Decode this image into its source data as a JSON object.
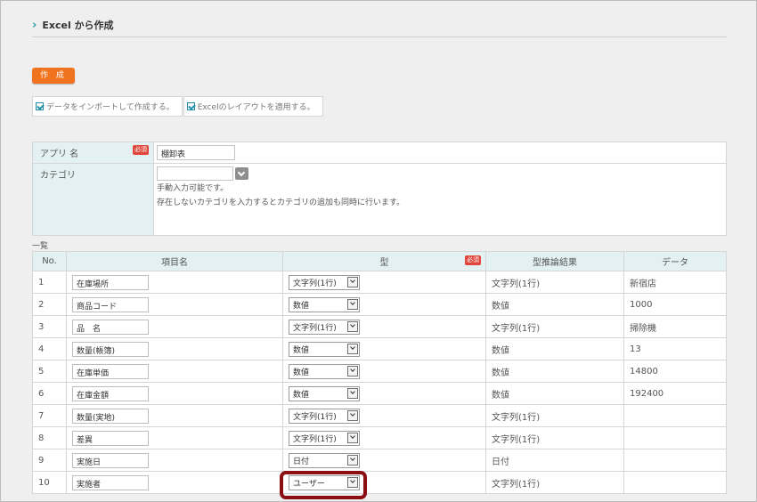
{
  "page": {
    "title": "Excel から作成",
    "chevron_icon": "chevron-right-icon"
  },
  "create_button": {
    "label": "作 成",
    "color": "#f0731f"
  },
  "options": [
    {
      "label": "データをインポートして作成する。",
      "checked": true
    },
    {
      "label": "Excelのレイアウトを適用する。",
      "checked": true
    }
  ],
  "form": {
    "app_name": {
      "label": "アプリ 名",
      "required_badge": "必須",
      "value": "棚卸表"
    },
    "category": {
      "label": "カテゴリ",
      "value": "",
      "note1": "手動入力可能です。",
      "note2": "存在しないカテゴリを入力するとカテゴリの追加も同時に行います。"
    }
  },
  "list": {
    "label": "一覧",
    "headers": {
      "no": "No.",
      "item_name": "項目名",
      "type": "型",
      "required_badge": "必須",
      "inference": "型推論結果",
      "data": "データ"
    },
    "rows": [
      {
        "no": "1",
        "name": "在庫場所",
        "type": "文字列(1行)",
        "inferred": "文字列(1行)",
        "data": "新宿店"
      },
      {
        "no": "2",
        "name": "商品コード",
        "type": "数値",
        "inferred": "数値",
        "data": "1000"
      },
      {
        "no": "3",
        "name": "品　名",
        "type": "文字列(1行)",
        "inferred": "文字列(1行)",
        "data": "掃除機"
      },
      {
        "no": "4",
        "name": "数量(帳簿)",
        "type": "数値",
        "inferred": "数値",
        "data": "13"
      },
      {
        "no": "5",
        "name": "在庫単価",
        "type": "数値",
        "inferred": "数値",
        "data": "14800"
      },
      {
        "no": "6",
        "name": "在庫金額",
        "type": "数値",
        "inferred": "数値",
        "data": "192400"
      },
      {
        "no": "7",
        "name": "数量(実地)",
        "type": "文字列(1行)",
        "inferred": "文字列(1行)",
        "data": ""
      },
      {
        "no": "8",
        "name": "差異",
        "type": "文字列(1行)",
        "inferred": "文字列(1行)",
        "data": ""
      },
      {
        "no": "9",
        "name": "実施日",
        "type": "日付",
        "inferred": "日付",
        "data": ""
      },
      {
        "no": "10",
        "name": "実施者",
        "type": "ユーザー",
        "inferred": "文字列(1行)",
        "data": ""
      }
    ]
  },
  "colors": {
    "accent": "#2a9fb2",
    "header_bg": "#e3f1f2",
    "required": "#e0463b",
    "highlight": "#8b0f12"
  }
}
